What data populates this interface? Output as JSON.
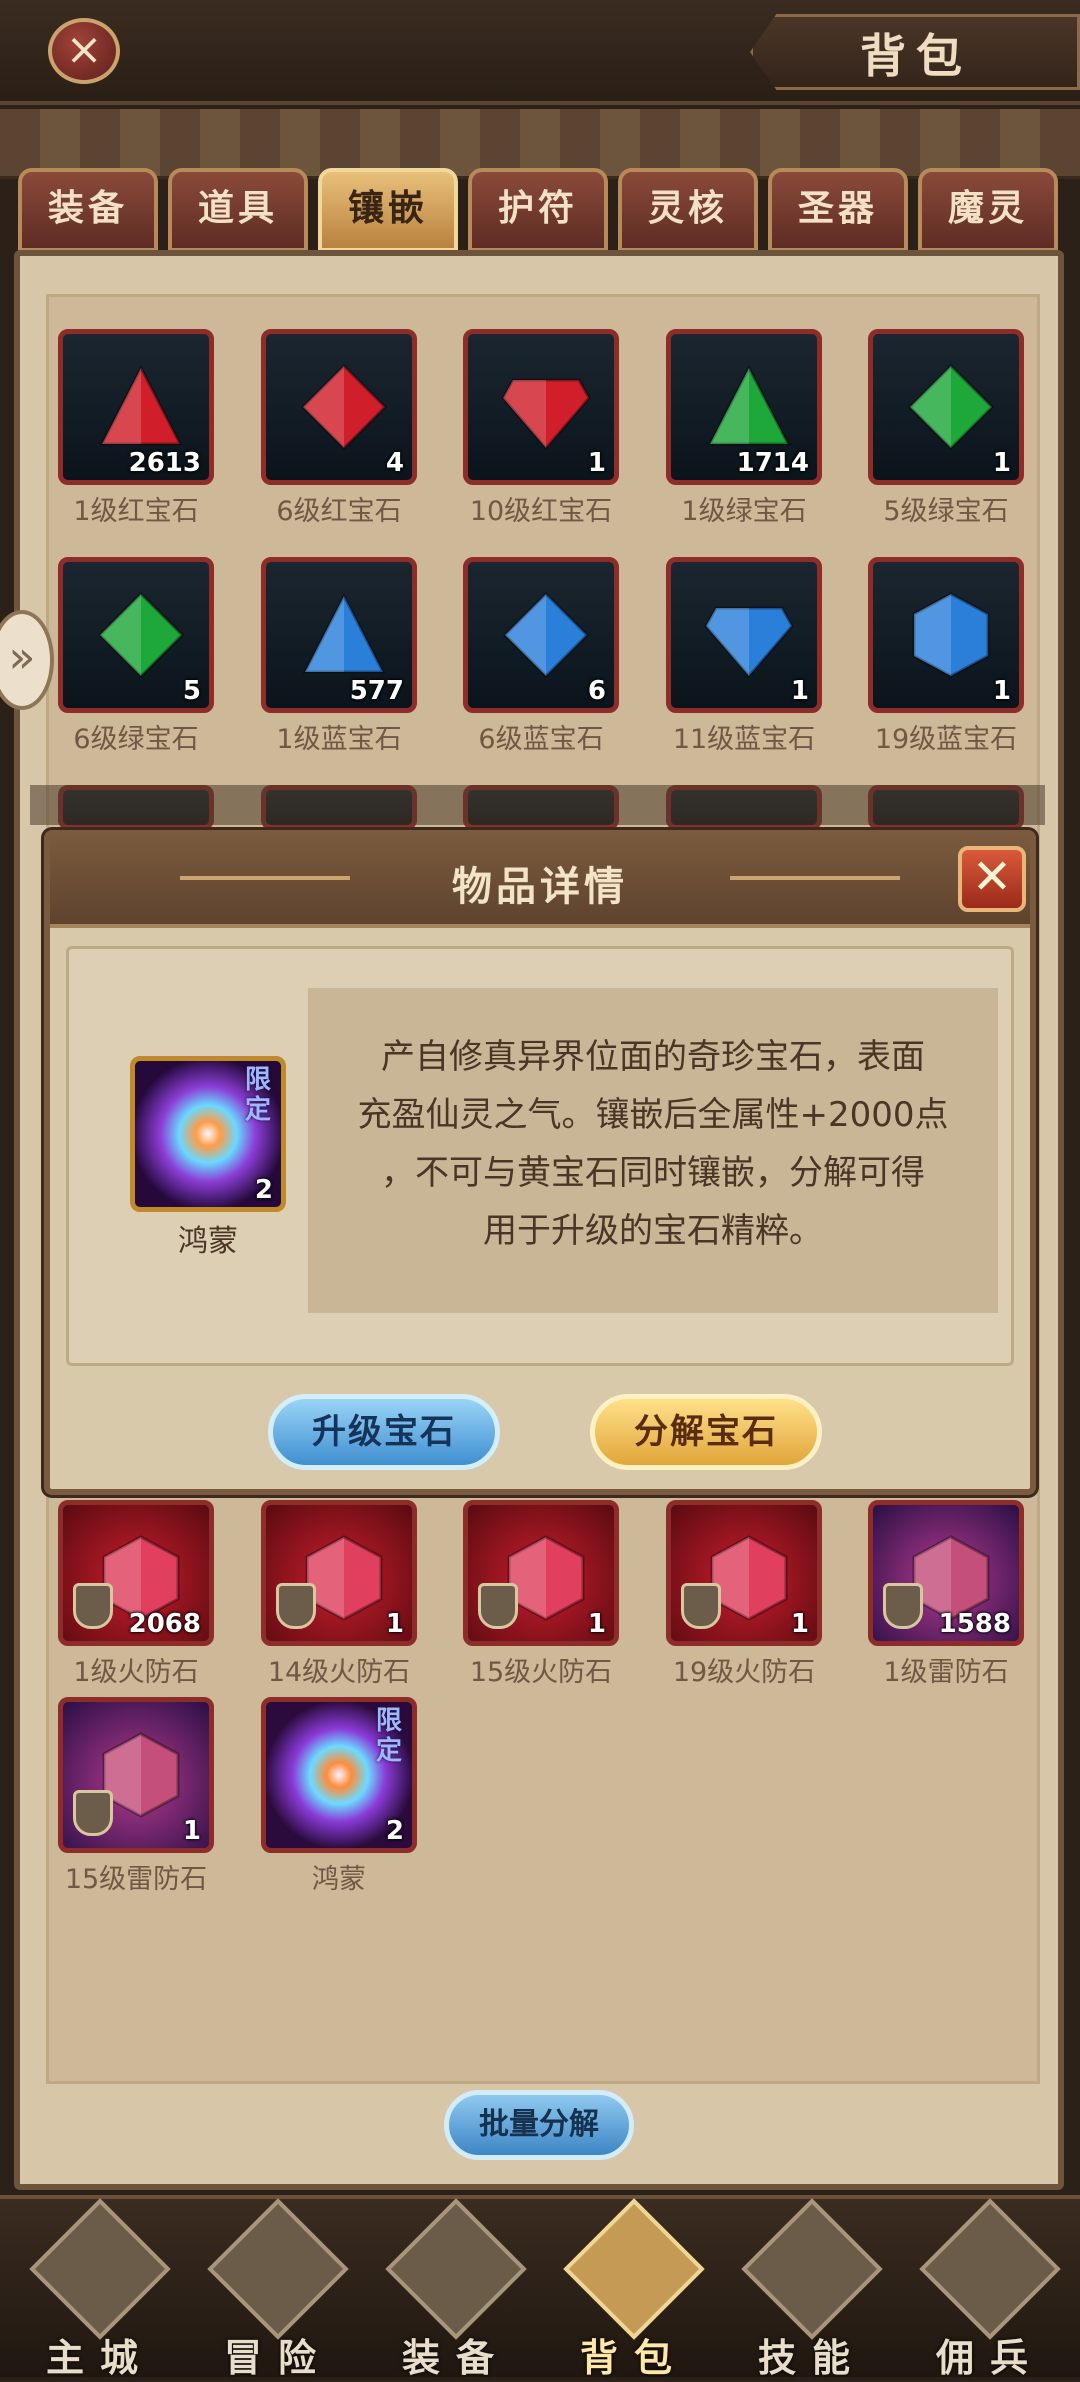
{
  "header": {
    "close_symbol": "×",
    "title": "背包"
  },
  "tabs": [
    {
      "label": "装备",
      "active": false
    },
    {
      "label": "道具",
      "active": false
    },
    {
      "label": "镶嵌",
      "active": true
    },
    {
      "label": "护符",
      "active": false
    },
    {
      "label": "灵核",
      "active": false
    },
    {
      "label": "圣器",
      "active": false
    },
    {
      "label": "魔灵",
      "active": false
    }
  ],
  "side_arrow": "»",
  "grid_items": [
    {
      "name": "1级红宝石",
      "count": "2613",
      "kind": "gem",
      "color": "#d01f2a",
      "shape": "triangle"
    },
    {
      "name": "6级红宝石",
      "count": "4",
      "kind": "gem",
      "color": "#d01f2a",
      "shape": "diamond"
    },
    {
      "name": "10级红宝石",
      "count": "1",
      "kind": "gem",
      "color": "#d01f2a",
      "shape": "heart"
    },
    {
      "name": "1级绿宝石",
      "count": "1714",
      "kind": "gem",
      "color": "#1fa83a",
      "shape": "triangle"
    },
    {
      "name": "5级绿宝石",
      "count": "1",
      "kind": "gem",
      "color": "#1fa83a",
      "shape": "diamond"
    },
    {
      "name": "6级绿宝石",
      "count": "5",
      "kind": "gem",
      "color": "#1fa83a",
      "shape": "diamond"
    },
    {
      "name": "1级蓝宝石",
      "count": "577",
      "kind": "gem",
      "color": "#2a7fd9",
      "shape": "triangle"
    },
    {
      "name": "6级蓝宝石",
      "count": "6",
      "kind": "gem",
      "color": "#2a7fd9",
      "shape": "diamond"
    },
    {
      "name": "11级蓝宝石",
      "count": "1",
      "kind": "gem",
      "color": "#2a7fd9",
      "shape": "heart"
    },
    {
      "name": "19级蓝宝石",
      "count": "1",
      "kind": "gem",
      "color": "#2a7fd9",
      "shape": "hexagon"
    }
  ],
  "bottom_items": [
    {
      "name": "1级火防石",
      "count": "2068",
      "kind": "fire"
    },
    {
      "name": "14级火防石",
      "count": "1",
      "kind": "fire"
    },
    {
      "name": "15级火防石",
      "count": "1",
      "kind": "fire"
    },
    {
      "name": "19级火防石",
      "count": "1",
      "kind": "fire"
    },
    {
      "name": "1级雷防石",
      "count": "1588",
      "kind": "thunder"
    },
    {
      "name": "15级雷防石",
      "count": "1",
      "kind": "thunder"
    },
    {
      "name": "鸿蒙",
      "count": "2",
      "kind": "chaos",
      "limited": "限定"
    }
  ],
  "modal": {
    "title": "物品详情",
    "close_symbol": "✕",
    "item_name": "鸿蒙",
    "item_count": "2",
    "limited": "限定",
    "description_lines": [
      "产自修真异界位面的奇珍宝石，表面",
      "充盈仙灵之气。镶嵌后全属性+2000点",
      "，不可与黄宝石同时镶嵌，分解可得",
      "用于升级的宝石精粹。"
    ],
    "upgrade_button": "升级宝石",
    "decompose_button": "分解宝石"
  },
  "batch_button": "批量分解",
  "bottom_nav": [
    {
      "label": "主城",
      "icon": "castle-icon",
      "active": false
    },
    {
      "label": "冒险",
      "icon": "crossed-swords-icon",
      "active": false
    },
    {
      "label": "装备",
      "icon": "helmet-icon",
      "active": false
    },
    {
      "label": "背包",
      "icon": "bag-icon",
      "active": true
    },
    {
      "label": "技能",
      "icon": "skill-book-icon",
      "active": false
    },
    {
      "label": "佣兵",
      "icon": "knight-icon",
      "active": false
    }
  ]
}
